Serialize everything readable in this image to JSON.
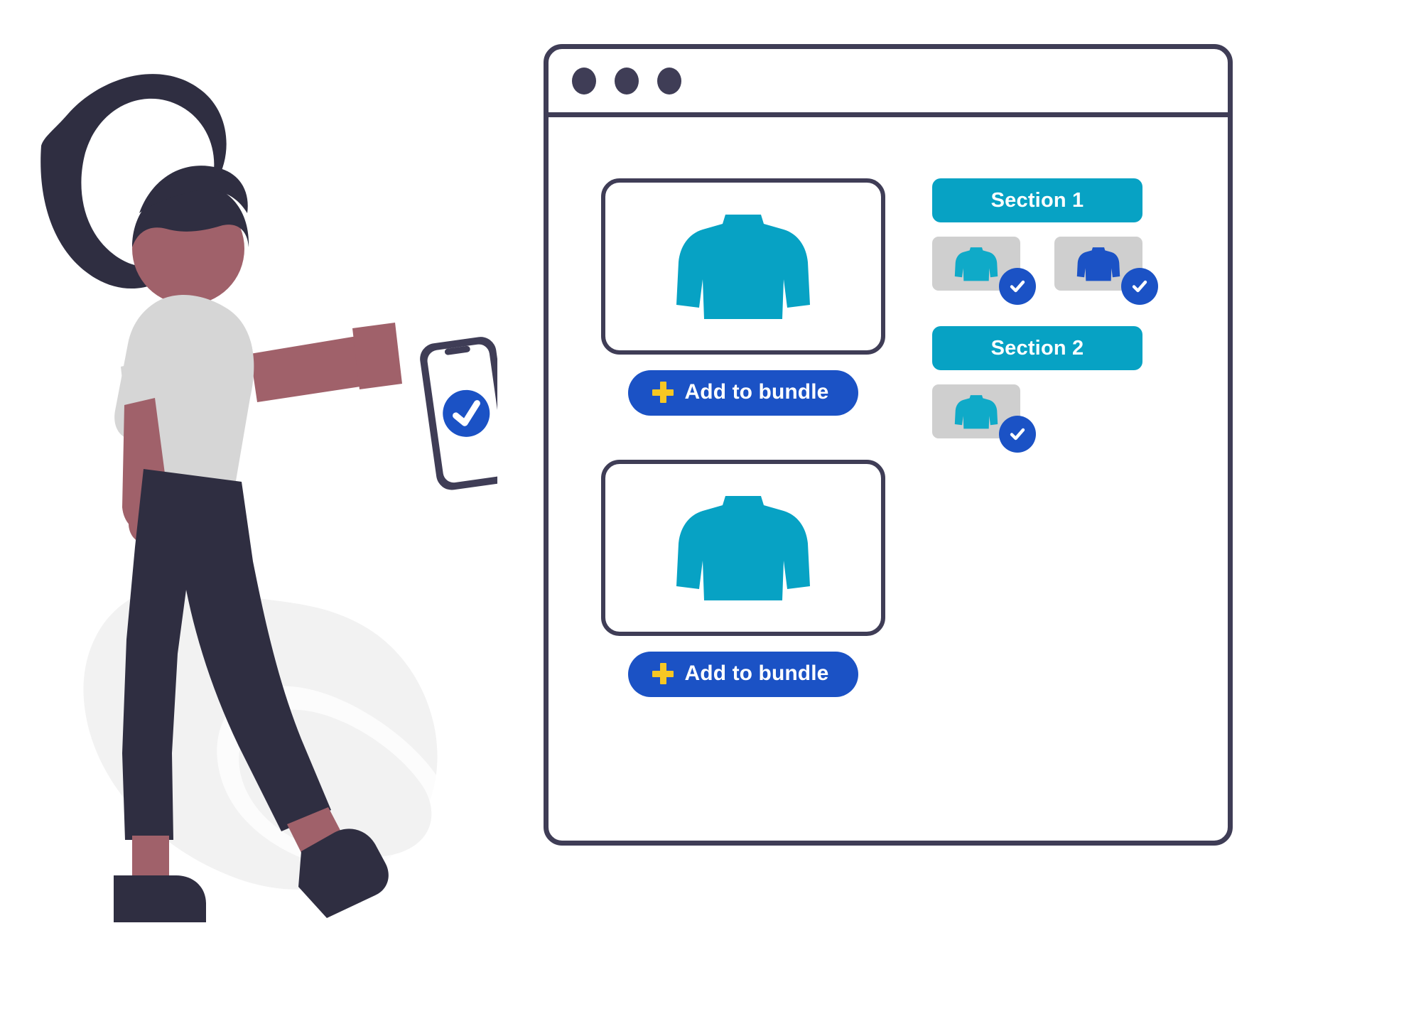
{
  "window": {
    "title_dots": 3,
    "dot_color": "#3F3D56",
    "border_color": "#3F3D56"
  },
  "colors": {
    "teal": "#07A2C4",
    "blue": "#1B52C5",
    "gold": "#F6C723",
    "navy": "#3F3D56",
    "skin": "#A0616A",
    "shirt": "#D6D6D6",
    "hair": "#2F2E41",
    "thumb_bg": "#CFCFCF",
    "blob": "#F2F2F2"
  },
  "products": [
    {
      "name": "sweater-product-1",
      "image": "sweater-icon",
      "image_color": "#07A2C4",
      "button": {
        "label": "Add to bundle",
        "icon": "plus-icon"
      }
    },
    {
      "name": "sweater-product-2",
      "image": "sweater-icon",
      "image_color": "#07A2C4",
      "button": {
        "label": "Add to bundle",
        "icon": "plus-icon"
      }
    }
  ],
  "sections": [
    {
      "label": "Section 1",
      "thumbnails": [
        {
          "name": "thumbnail-teal-sweater",
          "image": "sweater-icon",
          "image_color": "#0FAAC8",
          "selected": true,
          "check_icon": "check-icon"
        },
        {
          "name": "thumbnail-blue-sweater",
          "image": "sweater-icon",
          "image_color": "#1B52C5",
          "selected": true,
          "check_icon": "check-icon"
        }
      ]
    },
    {
      "label": "Section 2",
      "thumbnails": [
        {
          "name": "thumbnail-teal-sweater",
          "image": "sweater-icon",
          "image_color": "#0FAAC8",
          "selected": true,
          "check_icon": "check-icon"
        }
      ]
    }
  ],
  "illustration": {
    "name": "woman-holding-phone",
    "phone": {
      "icon": "check-badge-icon",
      "badge_color": "#1B52C5"
    }
  }
}
